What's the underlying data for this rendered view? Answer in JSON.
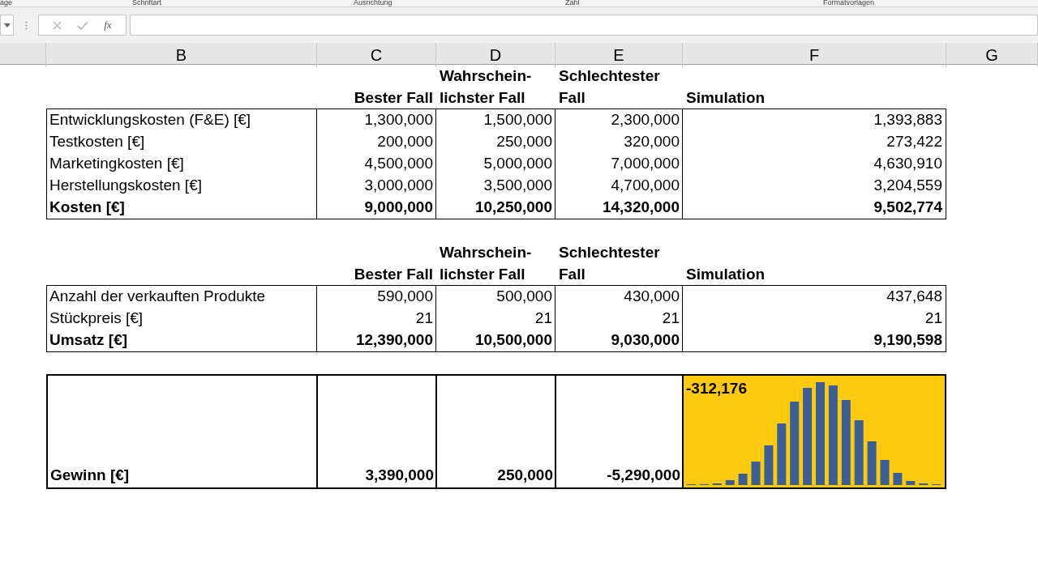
{
  "ribbon_groups": [
    "age",
    "Schriftart",
    "Ausrichtung",
    "Zahl",
    "Formatvorlagen"
  ],
  "formula_bar": {
    "function_label": "fx"
  },
  "columns": [
    "B",
    "C",
    "D",
    "E",
    "F",
    "G"
  ],
  "cost_table": {
    "headers": [
      [
        "Bester Fall"
      ],
      [
        "Wahrschein-",
        "lichster Fall"
      ],
      [
        "Schlechtester",
        "Fall"
      ],
      [
        "Simulation"
      ]
    ],
    "rows": [
      {
        "label": "Entwicklungskosten (F&E) [€]",
        "values": [
          "1,300,000",
          "1,500,000",
          "2,300,000",
          "1,393,883"
        ],
        "total": false
      },
      {
        "label": "Testkosten [€]",
        "values": [
          "200,000",
          "250,000",
          "320,000",
          "273,422"
        ],
        "total": false
      },
      {
        "label": "Marketingkosten [€]",
        "values": [
          "4,500,000",
          "5,000,000",
          "7,000,000",
          "4,630,910"
        ],
        "total": false
      },
      {
        "label": "Herstellungskosten [€]",
        "values": [
          "3,000,000",
          "3,500,000",
          "4,700,000",
          "3,204,559"
        ],
        "total": false
      },
      {
        "label": "Kosten [€]",
        "values": [
          "9,000,000",
          "10,250,000",
          "14,320,000",
          "9,502,774"
        ],
        "total": true
      }
    ]
  },
  "revenue_table": {
    "headers": [
      [
        "Bester Fall"
      ],
      [
        "Wahrschein-",
        "lichster Fall"
      ],
      [
        "Schlechtester",
        "Fall"
      ],
      [
        "Simulation"
      ]
    ],
    "rows": [
      {
        "label": "Anzahl der verkauften Produkte",
        "values": [
          "590,000",
          "500,000",
          "430,000",
          "437,648"
        ],
        "total": false
      },
      {
        "label": "Stückpreis [€]",
        "values": [
          "21",
          "21",
          "21",
          "21"
        ],
        "total": false
      },
      {
        "label": "Umsatz [€]",
        "values": [
          "12,390,000",
          "10,500,000",
          "9,030,000",
          "9,190,598"
        ],
        "total": true
      }
    ]
  },
  "profit": {
    "label": "Gewinn [€]",
    "values": [
      "3,390,000",
      "250,000",
      "-5,290,000"
    ],
    "simulation": "-312,176"
  }
}
